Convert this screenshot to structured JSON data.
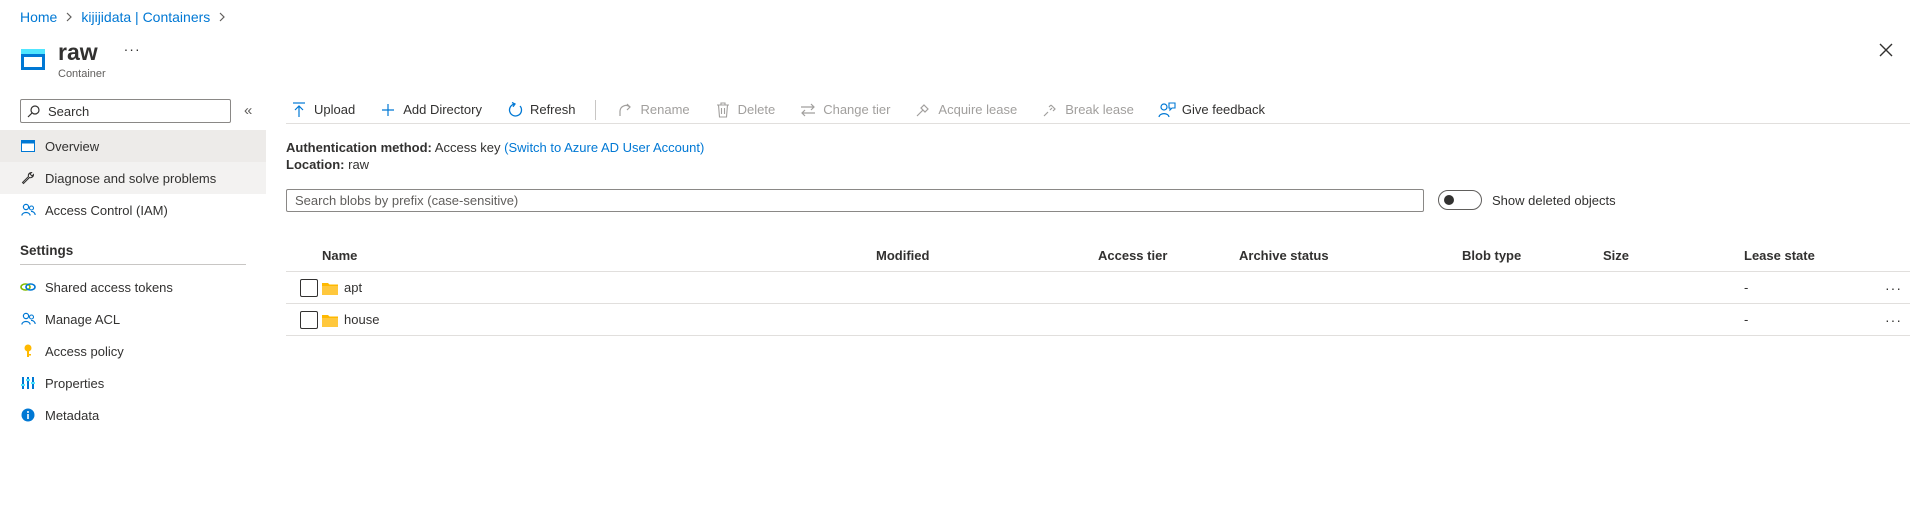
{
  "breadcrumb": [
    {
      "label": "Home"
    },
    {
      "label": "kijijidata | Containers"
    }
  ],
  "header": {
    "title": "raw",
    "subtitle": "Container",
    "more_label": "···"
  },
  "sidebar": {
    "search_placeholder": "Search",
    "collapse_label": "«",
    "items": [
      {
        "label": "Overview",
        "icon": "overview-icon"
      },
      {
        "label": "Diagnose and solve problems",
        "icon": "wrench-icon"
      },
      {
        "label": "Access Control (IAM)",
        "icon": "people-icon"
      }
    ],
    "settings_heading": "Settings",
    "settings_items": [
      {
        "label": "Shared access tokens",
        "icon": "link-icon"
      },
      {
        "label": "Manage ACL",
        "icon": "people-icon"
      },
      {
        "label": "Access policy",
        "icon": "key-icon"
      },
      {
        "label": "Properties",
        "icon": "properties-icon"
      },
      {
        "label": "Metadata",
        "icon": "info-icon"
      }
    ]
  },
  "toolbar": {
    "upload": "Upload",
    "add_directory": "Add Directory",
    "refresh": "Refresh",
    "rename": "Rename",
    "delete": "Delete",
    "change_tier": "Change tier",
    "acquire_lease": "Acquire lease",
    "break_lease": "Break lease",
    "give_feedback": "Give feedback"
  },
  "auth": {
    "method_label": "Authentication method:",
    "method_value": "Access key",
    "switch_link": "(Switch to Azure AD User Account)",
    "location_label": "Location:",
    "location_value": "raw"
  },
  "blob_search": {
    "placeholder": "Search blobs by prefix (case-sensitive)"
  },
  "show_deleted": {
    "label": "Show deleted objects",
    "on": false
  },
  "table": {
    "columns": [
      "Name",
      "Modified",
      "Access tier",
      "Archive status",
      "Blob type",
      "Size",
      "Lease state"
    ],
    "rows": [
      {
        "name": "apt",
        "modified": "",
        "access_tier": "",
        "archive_status": "",
        "blob_type": "",
        "size": "",
        "lease_state": "-"
      },
      {
        "name": "house",
        "modified": "",
        "access_tier": "",
        "archive_status": "",
        "blob_type": "",
        "size": "",
        "lease_state": "-"
      }
    ],
    "row_more_label": "···"
  },
  "colors": {
    "accent": "#0078d4",
    "folder": "#ffb900",
    "nav_active": "#edebe9"
  }
}
